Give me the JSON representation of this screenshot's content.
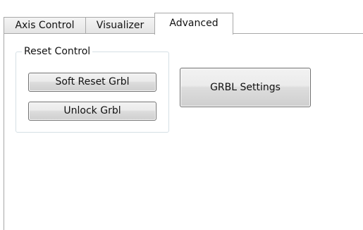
{
  "tabs": [
    {
      "label": "Axis Control",
      "selected": false
    },
    {
      "label": "Visualizer",
      "selected": false
    },
    {
      "label": "Advanced",
      "selected": true
    }
  ],
  "reset_control": {
    "title": "Reset Control",
    "soft_reset_label": "Soft Reset Grbl",
    "unlock_label": "Unlock Grbl"
  },
  "grbl_settings_label": "GRBL Settings"
}
